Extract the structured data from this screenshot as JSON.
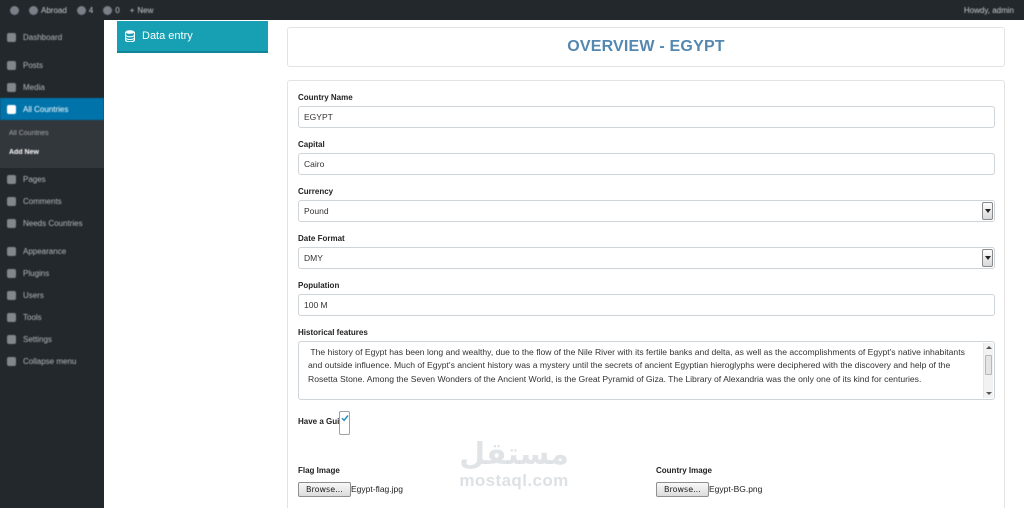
{
  "admin_bar": {
    "site_name": "Abroad",
    "updates": "4",
    "comments": "0",
    "new_label": "New",
    "greeting": "Howdy, admin"
  },
  "sidebar": {
    "items": [
      {
        "label": "Dashboard",
        "icon": "dashboard-icon"
      },
      {
        "label": "Posts",
        "icon": "pin-icon"
      },
      {
        "label": "Media",
        "icon": "media-icon"
      },
      {
        "label": "All Countries",
        "icon": "globe-icon",
        "active": true
      }
    ],
    "submenu": [
      {
        "label": "All Countries"
      },
      {
        "label": "Add New",
        "current": true
      }
    ],
    "items_after": [
      {
        "label": "Pages",
        "icon": "page-icon"
      },
      {
        "label": "Comments",
        "icon": "comment-icon"
      },
      {
        "label": "Needs Countries",
        "icon": "pin-icon"
      },
      {
        "label": "Appearance",
        "icon": "brush-icon"
      },
      {
        "label": "Plugins",
        "icon": "plugin-icon"
      },
      {
        "label": "Users",
        "icon": "users-icon"
      },
      {
        "label": "Tools",
        "icon": "wrench-icon"
      },
      {
        "label": "Settings",
        "icon": "settings-icon"
      },
      {
        "label": "Collapse menu",
        "icon": "collapse-icon"
      }
    ]
  },
  "tab": {
    "label": "Data entry",
    "icon": "database-icon"
  },
  "header": {
    "title": "OVERVIEW - EGYPT"
  },
  "form": {
    "country_name": {
      "label": "Country Name",
      "value": "EGYPT"
    },
    "capital": {
      "label": "Capital",
      "value": "Cairo"
    },
    "currency": {
      "label": "Currency",
      "value": "Pound"
    },
    "date_format": {
      "label": "Date Format",
      "value": "DMY"
    },
    "population": {
      "label": "Population",
      "value": "100 M"
    },
    "historical": {
      "label": "Historical features",
      "value": " The history of Egypt has been long and wealthy, due to the flow of the Nile River with its fertile banks and delta, as well as the accomplishments of Egypt's native inhabitants and outside influence. Much of Egypt's ancient history was a mystery until the secrets of ancient Egyptian hieroglyphs were deciphered with the discovery and help of the Rosetta Stone. Among the Seven Wonders of the Ancient World, is the Great Pyramid of Giza. The Library of Alexandria was the only one of its kind for centuries."
    },
    "guide": {
      "label": "Have a Guide",
      "checked": true
    },
    "flag_image": {
      "label": "Flag Image",
      "button": "Browse...",
      "file": "Egypt-flag.jpg"
    },
    "country_image": {
      "label": "Country Image",
      "button": "Browse...",
      "file": "Egypt-BG.png"
    }
  },
  "watermark": {
    "arabic": "مستقل",
    "latin": "mostaql.com"
  },
  "colors": {
    "tab": "#17a0b3",
    "title": "#5488b0",
    "active_menu": "#0073aa",
    "sidebar": "#23282d"
  }
}
